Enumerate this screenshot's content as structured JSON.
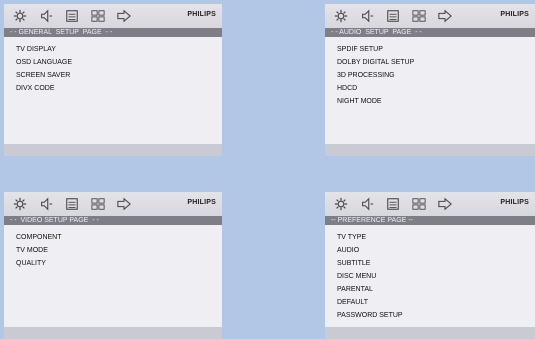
{
  "brand": "PHILIPS",
  "panels": [
    {
      "page_title": "- - GENERAL  SETUP  PAGE  - -",
      "items": [
        "TV DISPLAY",
        "OSD LANGUAGE",
        "SCREEN SAVER",
        "DIVX CODE"
      ]
    },
    {
      "page_title": "- - AUDIO  SETUP  PAGE  - -",
      "items": [
        "SPDIF SETUP",
        "DOLBY DIGITAL SETUP",
        "3D PROCESSING",
        "HDCD",
        "NIGHT MODE"
      ]
    },
    {
      "page_title": "- -  VIDEO SETUP PAGE  - -",
      "items": [
        "COMPONENT",
        "TV MODE",
        "QUALITY"
      ]
    },
    {
      "page_title": "-- PREFERENCE PAGE --",
      "items": [
        "TV TYPE",
        "AUDIO",
        "SUBTITLE",
        "DISC MENU",
        "PARENTAL",
        "DEFAULT",
        "PASSWORD SETUP"
      ]
    }
  ],
  "icons": [
    "gear-icon",
    "speaker-icon",
    "screen-icon",
    "grid-icon",
    "exit-arrow-icon"
  ]
}
